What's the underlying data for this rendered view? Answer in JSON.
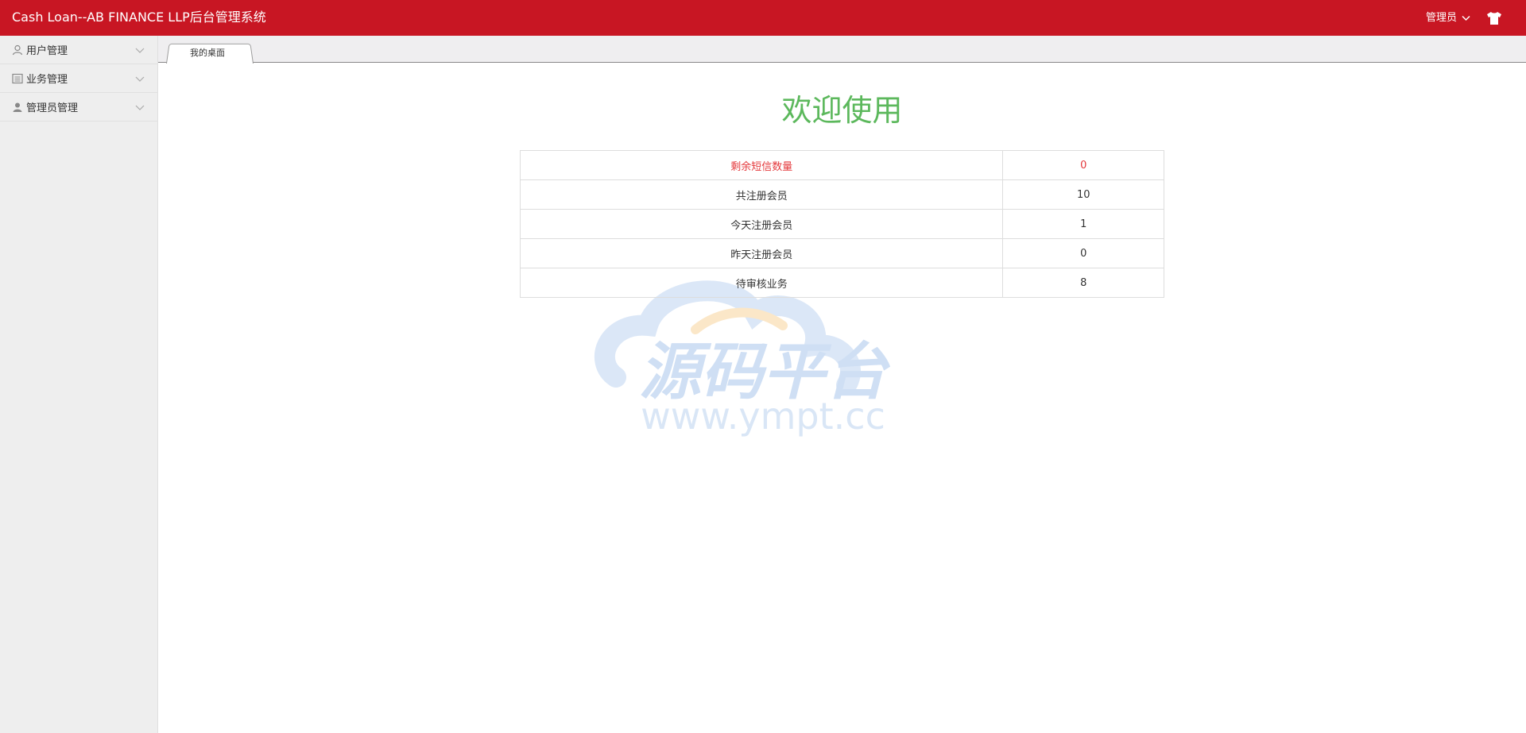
{
  "header": {
    "app_title": "Cash Loan--AB FINANCE LLP后台管理系统",
    "user_menu_label": "管理员",
    "skin_icon": "tshirt-icon"
  },
  "sidebar": {
    "items": [
      {
        "label": "用户管理",
        "icon": "user-outline-icon"
      },
      {
        "label": "业务管理",
        "icon": "document-list-icon"
      },
      {
        "label": "管理员管理",
        "icon": "user-solid-icon"
      }
    ]
  },
  "tabs": [
    {
      "label": "我的桌面",
      "active": true
    }
  ],
  "main": {
    "welcome": "欢迎使用",
    "stats": [
      {
        "label": "剩余短信数量",
        "value": "0",
        "highlight": true
      },
      {
        "label": "共注册会员",
        "value": "10",
        "highlight": false
      },
      {
        "label": "今天注册会员",
        "value": "1",
        "highlight": false
      },
      {
        "label": "昨天注册会员",
        "value": "0",
        "highlight": false
      },
      {
        "label": "待审核业务",
        "value": "8",
        "highlight": false
      }
    ]
  },
  "watermark": {
    "title": "源码平台",
    "url": "www.ympt.cc"
  },
  "colors": {
    "header_bg": "#c81623",
    "welcome": "#5cb85c",
    "alert": "#e4393c"
  }
}
